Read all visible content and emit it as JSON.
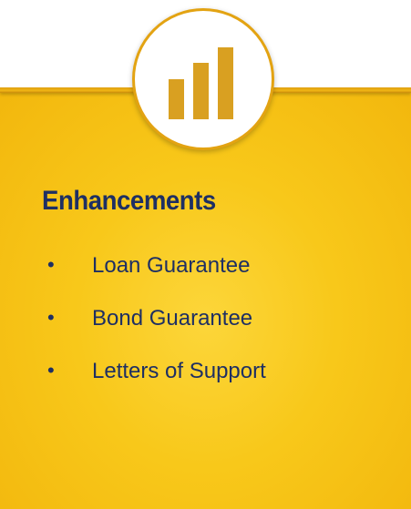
{
  "colors": {
    "panel": "#f8c81a",
    "accent": "#e3a312",
    "text": "#1e2f63",
    "badge_bg": "#ffffff"
  },
  "badge": {
    "icon": "bar-chart-icon"
  },
  "card": {
    "title": "Enhancements",
    "bullet_glyph": "•",
    "items": [
      {
        "label": "Loan Guarantee"
      },
      {
        "label": "Bond Guarantee"
      },
      {
        "label": "Letters of Support"
      }
    ]
  }
}
